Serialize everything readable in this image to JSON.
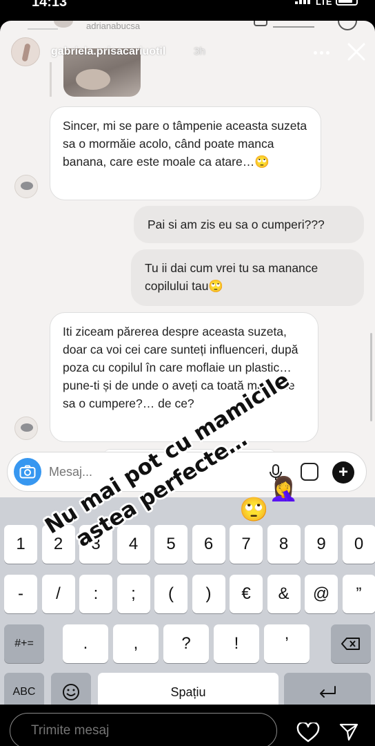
{
  "status_bar": {
    "time": "14:13",
    "network": "LTE"
  },
  "previous_story": {
    "username": "adrianabucsa"
  },
  "story": {
    "username": "gabriela.prisacariuotil",
    "time_ago": "3h"
  },
  "messages": [
    {
      "direction": "incoming",
      "text": "Sincer, mi se pare o tâmpenie aceasta suzeta sa o mormăie acolo, când poate manca banana, care este moale ca atare…🙄"
    },
    {
      "direction": "outgoing",
      "text": "Pai si am zis eu sa o cumperi???"
    },
    {
      "direction": "outgoing",
      "text": "Tu ii dai cum vrei tu sa manance copilului tau🙄"
    },
    {
      "direction": "incoming",
      "text": "Iti ziceam părerea despre aceasta suzeta, doar ca voi cei care sunteți influenceri, după poza cu copilul în care moflaie un plastic… pune-ti și de unde o aveți ca toată mamicile sa o cumpere?… de ce?"
    }
  ],
  "compose": {
    "placeholder": "Mesaj..."
  },
  "keyboard": {
    "row1": [
      "1",
      "2",
      "3",
      "4",
      "5",
      "6",
      "7",
      "8",
      "9",
      "0"
    ],
    "row2": [
      "-",
      "/",
      ":",
      ";",
      "(",
      ")",
      "€",
      "&",
      "@",
      "”"
    ],
    "row3_left": "#+=",
    "row3": [
      ".",
      ",",
      "?",
      "!",
      "’"
    ],
    "abc_label": "ABC",
    "space_label": "Spațiu"
  },
  "overlay": {
    "line1": "Nu mai pot cu mamicile",
    "line2": "astea perfecte…",
    "stickers": [
      "🙄",
      "🤦‍♀️"
    ]
  },
  "footer": {
    "placeholder": "Trimite mesaj"
  }
}
